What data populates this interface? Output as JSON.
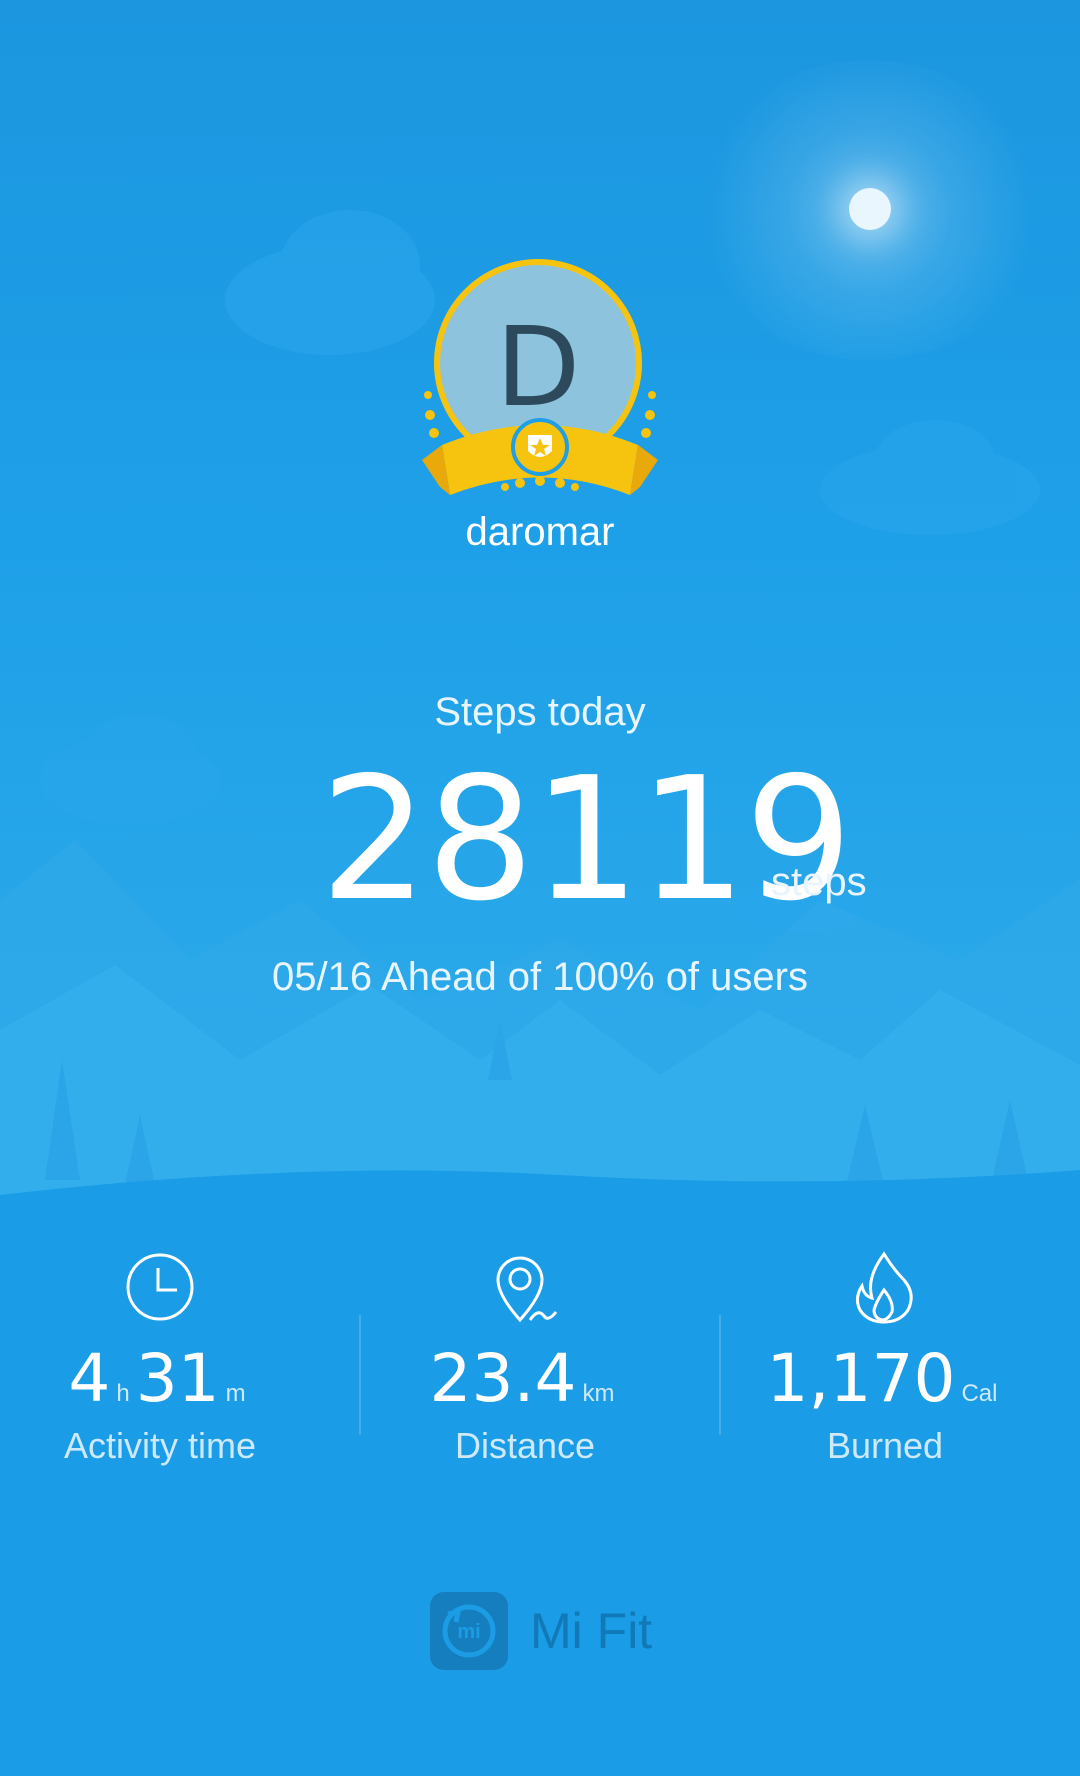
{
  "profile": {
    "avatar_letter": "D",
    "username": "daromar"
  },
  "steps": {
    "label": "Steps today",
    "value": "28119",
    "unit": "steps",
    "ranking": "05/16 Ahead of 100% of users"
  },
  "stats": {
    "activity": {
      "hours": "4",
      "hours_unit": "h",
      "minutes": "31",
      "minutes_unit": "m",
      "label": "Activity time",
      "icon": "clock-icon"
    },
    "distance": {
      "value": "23.4",
      "unit": "km",
      "label": "Distance",
      "icon": "location-pin-icon"
    },
    "burned": {
      "value": "1,170",
      "unit": "Cal",
      "label": "Burned",
      "icon": "flame-icon"
    }
  },
  "brand": {
    "name": "Mi Fit",
    "icon": "mi-logo-icon"
  },
  "colors": {
    "background": "#1c9ce5",
    "badge_gold": "#f6c40e",
    "avatar_fill": "#8ec3de"
  }
}
